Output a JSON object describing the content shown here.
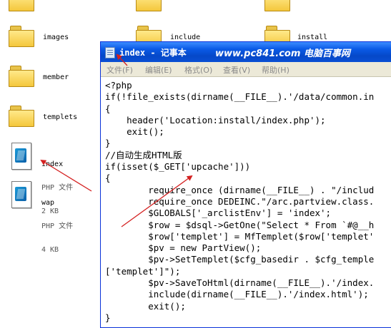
{
  "explorer": {
    "folders_top_row_partial": [
      "",
      "",
      ""
    ],
    "folders_row2": [
      {
        "label": "images"
      },
      {
        "label": "include"
      },
      {
        "label": "install"
      }
    ],
    "folders_col1": [
      {
        "label": "member"
      },
      {
        "label": "templets"
      }
    ],
    "files": [
      {
        "name": "index",
        "type": "PHP 文件",
        "size": "2 KB"
      },
      {
        "name": "wap",
        "type": "PHP 文件",
        "size": "4 KB"
      }
    ]
  },
  "notepad": {
    "title": "index - 记事本",
    "watermark": "www.pc841.com 电脑百事网",
    "menu": [
      "文件(F)",
      "编辑(E)",
      "格式(O)",
      "查看(V)",
      "帮助(H)"
    ],
    "code_lines": [
      "<?php",
      "if(!file_exists(dirname(__FILE__).'/data/common.in",
      "{",
      "    header('Location:install/index.php');",
      "    exit();",
      "}",
      "//自动生成HTML版",
      "if(isset($_GET['upcache']))",
      "{",
      "        require_once (dirname(__FILE__) . \"/includ",
      "        require_once DEDEINC.\"/arc.partview.class.",
      "        $GLOBALS['_arclistEnv'] = 'index';",
      "        $row = $dsql->GetOne(\"Select * From `#@__h",
      "        $row['templet'] = MfTemplet($row['templet'",
      "        $pv = new PartView();",
      "        $pv->SetTemplet($cfg_basedir . $cfg_temple",
      "['templet']\");",
      "        $pv->SaveToHtml(dirname(__FILE__).'/index.",
      "        include(dirname(__FILE__).'/index.html');",
      "        exit();",
      "}"
    ]
  },
  "colors": {
    "arrow": "#d42020",
    "titlebar": "#0a5ae6",
    "folder": "#f4c73c"
  }
}
